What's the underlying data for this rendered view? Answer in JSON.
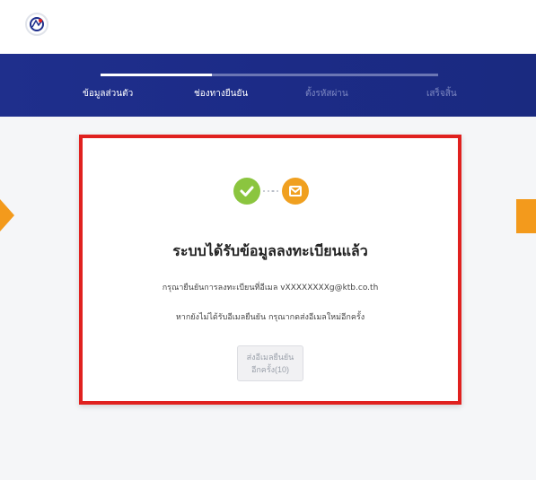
{
  "brand": {
    "logo_alt": ""
  },
  "progress": {
    "fraction": 0.33,
    "steps": [
      {
        "label": "ข้อมูลส่วนตัว",
        "state": "done"
      },
      {
        "label": "ช่องทางยืนยัน",
        "state": "current"
      },
      {
        "label": "ตั้งรหัสผ่าน",
        "state": "todo"
      },
      {
        "label": "เสร็จสิ้น",
        "state": "todo"
      }
    ]
  },
  "card": {
    "title": "ระบบได้รับข้อมูลลงทะเบียนแล้ว",
    "message_line1": "กรุณายืนยันการลงทะเบียนที่อีเมล vXXXXXXXXg@ktb.co.th",
    "message_line2": "หากยังไม่ได้รับอีเมลยืนยัน กรุณากดส่งอีเมลใหม่อีกครั้ง",
    "resend_button": "ส่งอีเมลยืนยันอีกครั้ง(10)"
  },
  "colors": {
    "banner": "#1f2f8c",
    "accent_orange": "#f39a1c",
    "success_green": "#8bc53f",
    "highlight_red": "#e0211f"
  }
}
